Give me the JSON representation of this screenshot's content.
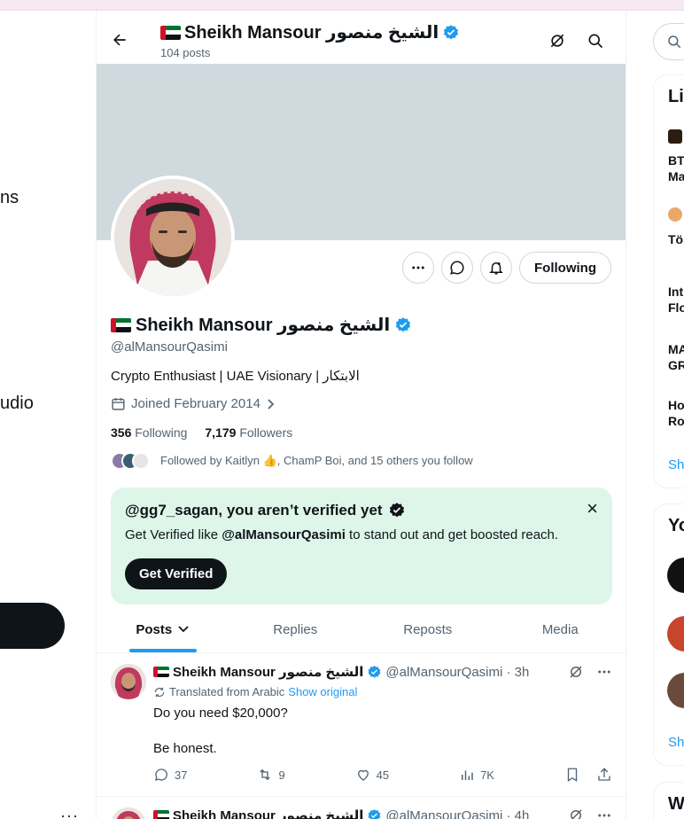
{
  "left_nav": {
    "fragment_1": "ns",
    "fragment_2": "udio",
    "more_label": "···"
  },
  "header": {
    "name": "Sheikh Mansour الشيخ منصور",
    "post_count": "104 posts"
  },
  "profile": {
    "name": "Sheikh Mansour الشيخ منصور",
    "handle": "@alMansourQasimi",
    "bio": "Crypto Enthusiast | UAE Visionary | الابتكار",
    "joined": "Joined February 2014",
    "following_count": "356",
    "following_label": "Following",
    "followers_count": "7,179",
    "followers_label": "Followers",
    "followed_by": "Followed by Kaitlyn 👍, ChamP Boi, and 15 others you follow",
    "follow_button": "Following"
  },
  "verify_card": {
    "title": "@gg7_sagan, you aren’t verified yet",
    "body_prefix": "Get Verified like ",
    "body_handle": "@alMansourQasimi",
    "body_suffix": " to stand out and get boosted reach.",
    "button": "Get Verified",
    "close": "×"
  },
  "tabs": [
    {
      "label": "Posts",
      "active": true
    },
    {
      "label": "Replies"
    },
    {
      "label": "Reposts"
    },
    {
      "label": "Media"
    }
  ],
  "tweets": [
    {
      "name": "Sheikh Mansour الشيخ منصور",
      "handle_time": "@alMansourQasimi · 3h",
      "translated": "Translated from Arabic",
      "show_original": "Show original",
      "text": "Do you need $20,000?\n\nBe honest.",
      "replies": "37",
      "reposts": "9",
      "likes": "45",
      "views": "7K"
    },
    {
      "name": "Sheikh Mansour الشيخ منصور",
      "handle_time": "@alMansourQasimi · 4h"
    }
  ],
  "right_col": {
    "live_heading": "Li",
    "item1": "BT",
    "item1b": "Ma",
    "item2": "Tö",
    "item3": "Int",
    "item3b": "Flo",
    "item4": "MA",
    "item4b": "GR",
    "item5": "Ho",
    "item5b": "Ro",
    "show_more": "Sh",
    "you_heading": "Yo",
    "show_more_2": "Sh",
    "what_heading": "W"
  },
  "colors": {
    "accent": "#1d9bf0",
    "verify_bg": "#def6ea",
    "banner": "#cfd9de"
  }
}
